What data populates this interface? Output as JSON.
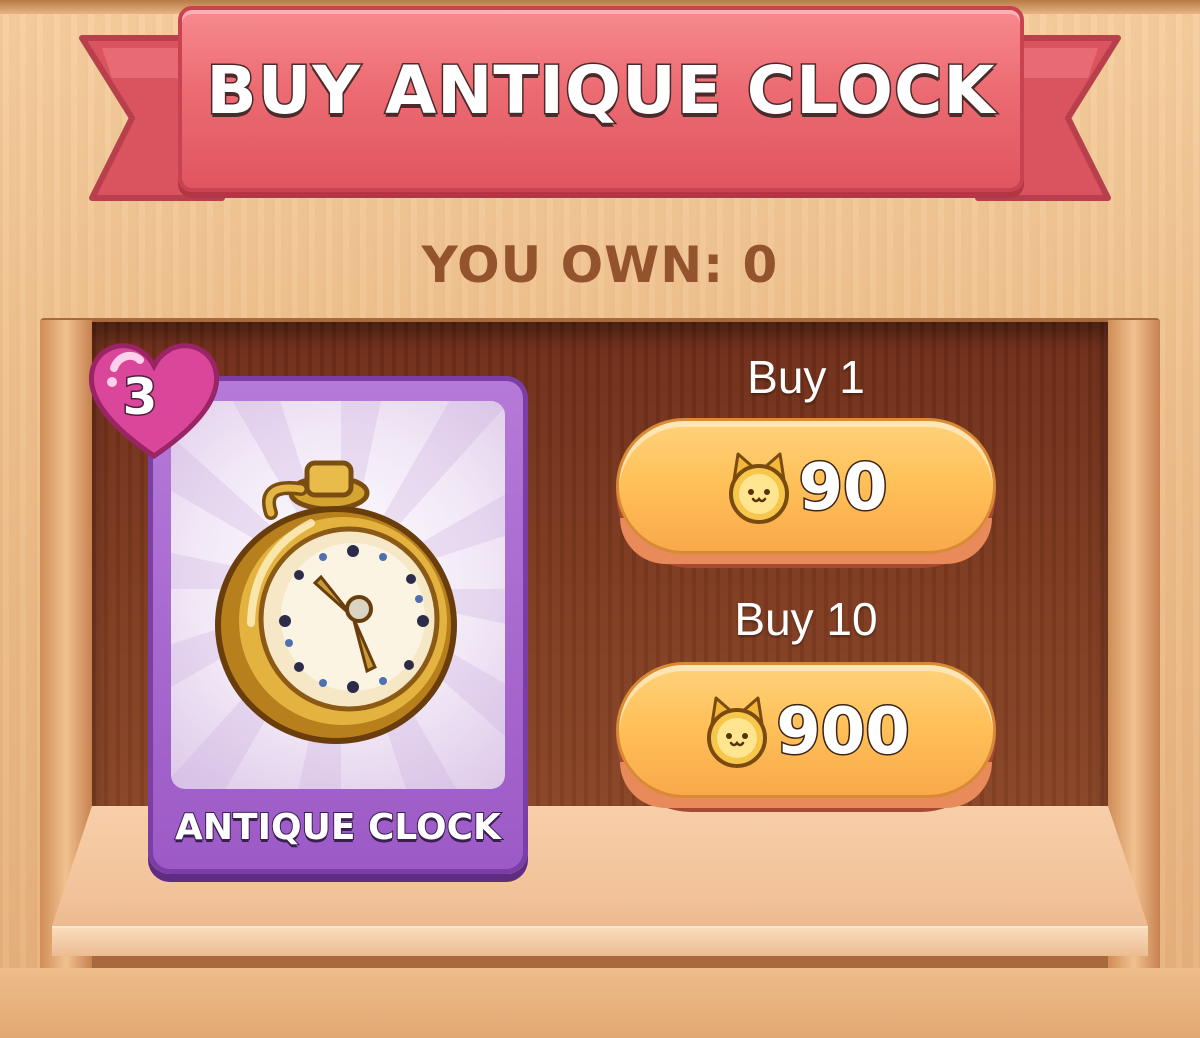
{
  "dialog": {
    "title": "BUY ANTIQUE CLOCK",
    "own_label": "YOU OWN: 0"
  },
  "item": {
    "name": "ANTIQUE CLOCK",
    "badge_value": "3",
    "badge_icon": "heart-icon",
    "image_icon": "pocket-watch-icon",
    "card_color": "#9c5ac6"
  },
  "purchase_options": [
    {
      "label": "Buy 1",
      "price": "90",
      "currency_icon": "cat-coin-icon"
    },
    {
      "label": "Buy 10",
      "price": "900",
      "currency_icon": "cat-coin-icon"
    }
  ],
  "colors": {
    "ribbon": "#ec6b72",
    "button": "#ffc15a",
    "own_text": "#93532c"
  }
}
